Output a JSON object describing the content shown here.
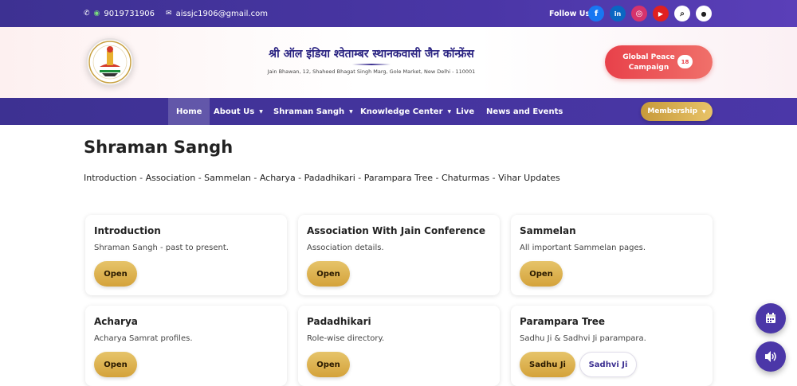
{
  "topbar": {
    "phone": "9019731906",
    "email": "aissjc1906@gmail.com",
    "follow_label": "Follow Us:",
    "social": [
      {
        "icon": "facebook-icon",
        "glyph": "f",
        "color": "#1877f2"
      },
      {
        "icon": "linkedin-icon",
        "glyph": "in",
        "color": "#0a66c2"
      },
      {
        "icon": "instagram-icon",
        "glyph": "◎",
        "color": "#d6336c"
      },
      {
        "icon": "youtube-icon",
        "glyph": "▶",
        "color": "#e02020"
      },
      {
        "icon": "search-icon",
        "glyph": "⌕",
        "color": "#ffffff"
      },
      {
        "icon": "location-icon",
        "glyph": "●",
        "color": "#ffffff"
      }
    ]
  },
  "header": {
    "org_name": "श्री ऑल इंडिया श्वेताम्बर स्थानकवासी जैन कॉन्फ्रेंस",
    "address": "Jain Bhawan, 12, Shaheed Bhagat Singh Marg, Gole Market, New Delhi - 110001",
    "campaign_label": "Global Peace Campaign",
    "campaign_badge": "18"
  },
  "nav": {
    "items": [
      {
        "label": "Home"
      },
      {
        "label": "About Us"
      },
      {
        "label": "Shraman Sangh"
      },
      {
        "label": "Knowledge Center"
      },
      {
        "label": "Live"
      },
      {
        "label": "News and Events"
      }
    ],
    "membership": "Membership"
  },
  "main": {
    "title": "Shraman Sangh",
    "subnav": "Introduction - Association - Sammelan - Acharya - Padadhikari - Parampara Tree - Chaturmas - Vihar Updates",
    "cards": [
      {
        "title": "Introduction",
        "desc": "Shraman Sangh - past to present.",
        "button": "Open"
      },
      {
        "title": "Association With Jain Conference",
        "desc": "Association details.",
        "button": "Open"
      },
      {
        "title": "Sammelan",
        "desc": "All important Sammelan pages.",
        "button": "Open"
      },
      {
        "title": "Acharya",
        "desc": "Acharya Samrat profiles.",
        "button": "Open"
      },
      {
        "title": "Padadhikari",
        "desc": "Role-wise directory.",
        "button": "Open"
      },
      {
        "title": "Parampara Tree",
        "desc": "Sadhu Ji & Sadhvi Ji parampara.",
        "button": "Sadhu Ji",
        "button2": "Sadhvi Ji"
      }
    ]
  },
  "colors": {
    "primary": "#3d3192",
    "accent_gold": "#d4a23a",
    "campaign_red": "#e8414a"
  }
}
